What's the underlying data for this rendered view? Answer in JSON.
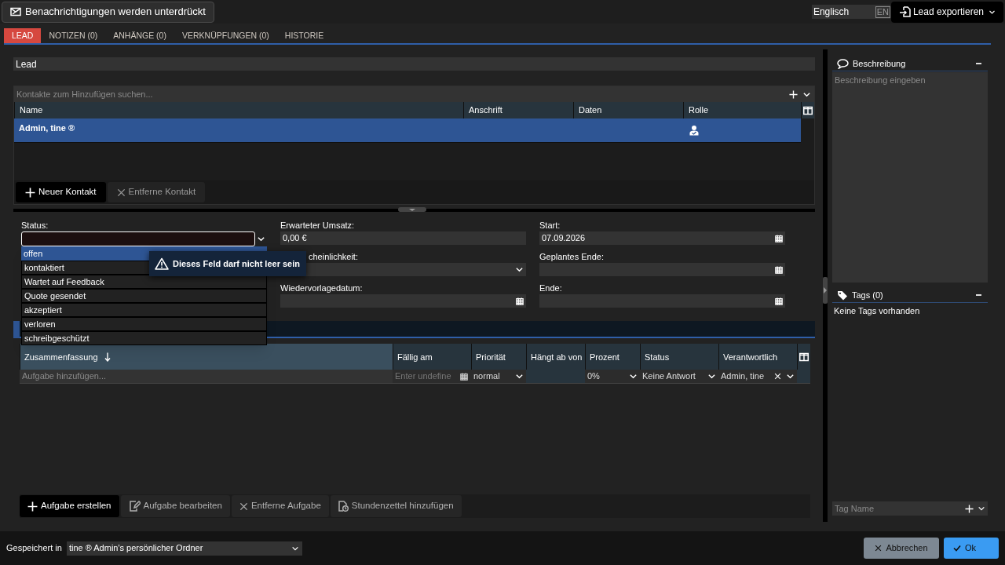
{
  "notification_button": {
    "label": "Benachrichtigungen werden unterdrückt"
  },
  "language": {
    "value": "Englisch",
    "code": "EN"
  },
  "export_button": {
    "label": "Lead exportieren"
  },
  "tabs": [
    {
      "label": "LEAD",
      "selected": true
    },
    {
      "label": "NOTIZEN (0)",
      "selected": false
    },
    {
      "label": "ANHÄNGE (0)",
      "selected": false
    },
    {
      "label": "VERKNÜPFUNGEN (0)",
      "selected": false
    },
    {
      "label": "HISTORIE",
      "selected": false
    }
  ],
  "lead_title": {
    "value": "Lead"
  },
  "contacts": {
    "search_placeholder": "Kontakte zum Hinzufügen suchen...",
    "columns": [
      "Name",
      "Anschrift",
      "Daten",
      "Rolle"
    ],
    "rows": [
      {
        "name": "Admin, tine ®",
        "selected": true
      }
    ],
    "buttons": [
      {
        "label": "Neuer Kontakt",
        "kind": "add",
        "disabled": false
      },
      {
        "label": "Entferne Kontakt",
        "kind": "remove",
        "disabled": true
      }
    ]
  },
  "form": {
    "status": {
      "label": "Status:",
      "invalid": true,
      "options": [
        {
          "label": "offen",
          "selected": true
        },
        {
          "label": "kontaktiert",
          "selected": false
        },
        {
          "label": "Wartet auf Feedback",
          "selected": false
        },
        {
          "label": "Quote gesendet",
          "selected": false
        },
        {
          "label": "akzeptiert",
          "selected": false
        },
        {
          "label": "verloren",
          "selected": false
        },
        {
          "label": "schreibgeschützt",
          "selected": false
        }
      ]
    },
    "error_tooltip": "Dieses Feld darf nicht leer sein",
    "column_2": [
      {
        "label": "Erwarteter Umsatz:",
        "value": "0,00 €",
        "kind": "text"
      },
      {
        "label": "cheinlichkeit:",
        "kind": "select"
      },
      {
        "label": "Wiedervorlagedatum:",
        "kind": "date"
      }
    ],
    "column_3": [
      {
        "label": "Start:",
        "value": "07.09.2026",
        "kind": "date"
      },
      {
        "label": "Geplantes Ende:",
        "kind": "date"
      },
      {
        "label": "Ende:",
        "kind": "date"
      }
    ]
  },
  "tasks": {
    "columns": [
      {
        "label": "Zusammenfassung",
        "sorted": true
      },
      {
        "label": "Fällig am",
        "sorted": false
      },
      {
        "label": "Priorität",
        "sorted": false
      },
      {
        "label": "Hängt ab von",
        "sorted": false
      },
      {
        "label": "Prozent",
        "sorted": false
      },
      {
        "label": "Status",
        "sorted": false
      },
      {
        "label": "Verantwortlich",
        "sorted": false
      }
    ],
    "new_row": {
      "summary_placeholder": "Aufgabe hinzufügen...",
      "due_placeholder": "Enter undefine",
      "priority": "normal",
      "percent": "0%",
      "status": "Keine Antwort",
      "responsible": "Admin, tine"
    },
    "buttons": [
      {
        "label": "Aufgabe erstellen",
        "kind": "add",
        "disabled": false
      },
      {
        "label": "Aufgabe bearbeiten",
        "kind": "edit",
        "disabled": true
      },
      {
        "label": "Entferne Aufgabe",
        "kind": "remove",
        "disabled": true
      },
      {
        "label": "Stundenzettel hinzufügen",
        "kind": "timesheet",
        "disabled": true
      }
    ]
  },
  "description": {
    "title": "Beschreibung",
    "placeholder": "Beschreibung eingeben"
  },
  "tags": {
    "title": "Tags (0)",
    "empty_text": "Keine Tags vorhanden",
    "input_placeholder": "Tag Name"
  },
  "footer": {
    "saved_in_label": "Gespeichert in",
    "saved_in_value": "tine ® Admin's persönlicher Ordner",
    "buttons": [
      {
        "label": "Abbrechen",
        "kind": "cancel"
      },
      {
        "label": "Ok",
        "kind": "ok"
      }
    ]
  }
}
